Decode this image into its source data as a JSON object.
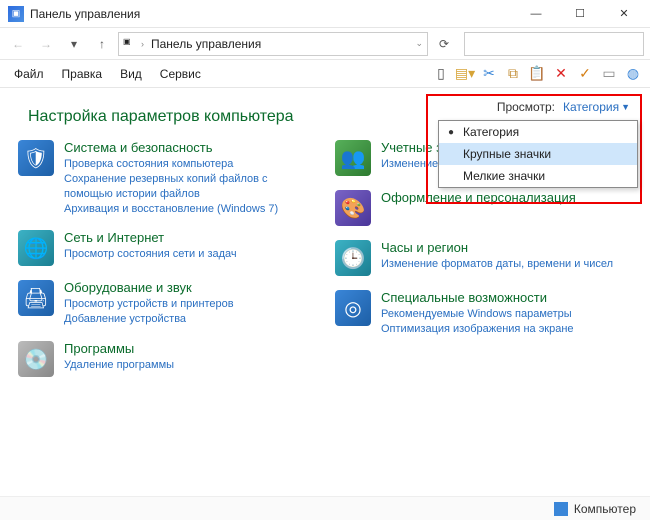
{
  "titlebar": {
    "title": "Панель управления"
  },
  "address": {
    "root": "Панель управления"
  },
  "menus": {
    "file": "Файл",
    "edit": "Правка",
    "view": "Вид",
    "service": "Сервис"
  },
  "heading": "Настройка параметров компьютера",
  "view_by": {
    "label": "Просмотр:",
    "value": "Категория"
  },
  "dropdown": {
    "items": [
      {
        "label": "Категория",
        "checked": true
      },
      {
        "label": "Крупные значки",
        "checked": false,
        "selected": true
      },
      {
        "label": "Мелкие значки",
        "checked": false
      }
    ]
  },
  "left": {
    "sys": {
      "title": "Система и безопасность",
      "l1": "Проверка состояния компьютера",
      "l2": "Сохранение резервных копий файлов с помощью истории файлов",
      "l3": "Архивация и восстановление (Windows 7)"
    },
    "net": {
      "title": "Сеть и Интернет",
      "l1": "Просмотр состояния сети и задач"
    },
    "hw": {
      "title": "Оборудование и звук",
      "l1": "Просмотр устройств и принтеров",
      "l2": "Добавление устройства"
    },
    "prog": {
      "title": "Программы",
      "l1": "Удаление программы"
    }
  },
  "right": {
    "accounts": {
      "title": "Учетные записи польз",
      "l1": "Изменение типа учетной з"
    },
    "appearance": {
      "title": "Оформление и персонализация"
    },
    "clock": {
      "title": "Часы и регион",
      "l1": "Изменение форматов даты, времени и чисел"
    },
    "ease": {
      "title": "Специальные возможности",
      "l1": "Рекомендуемые Windows параметры",
      "l2": "Оптимизация изображения на экране"
    }
  },
  "statusbar": {
    "label": "Компьютер"
  }
}
